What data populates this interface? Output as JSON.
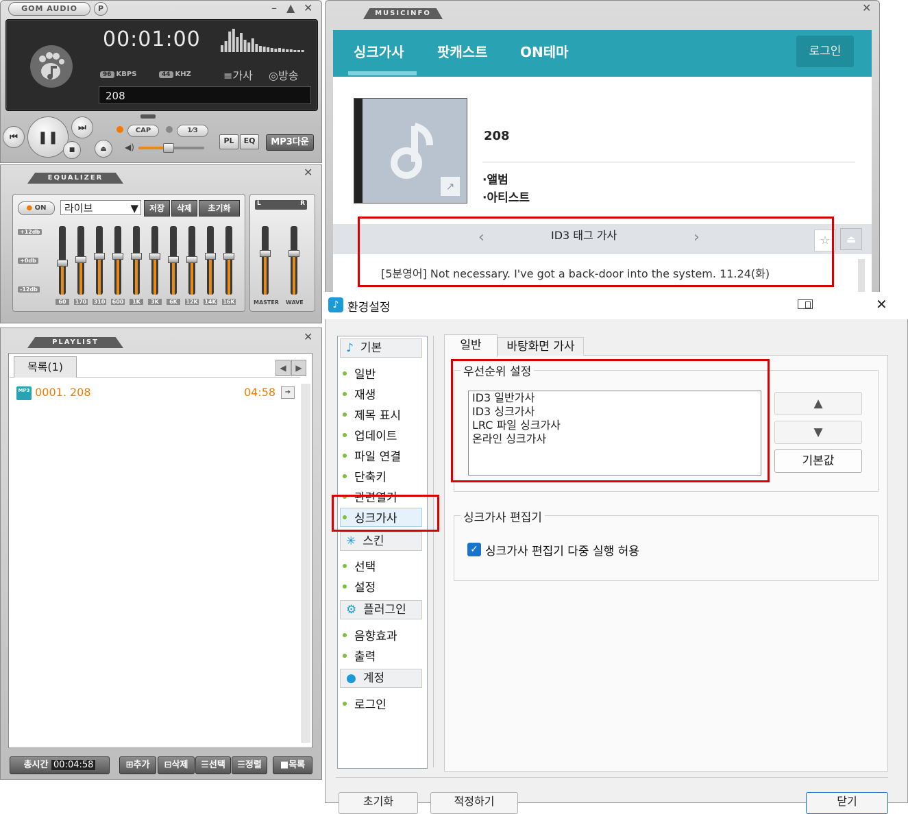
{
  "player": {
    "logo": "GOM AUDIO",
    "p_button": "P",
    "time": "00:01:00",
    "kbps_value": "96",
    "kbps_label": "KBPS",
    "khz_value": "44",
    "khz_label": "KHZ",
    "lyrics_label": "가사",
    "broadcast_label": "방송",
    "track_title": "208",
    "cap_label": "CAP",
    "repeat_label": "1⁄3",
    "pl_label": "PL",
    "eq_label": "EQ",
    "mp3_label": "MP3다운",
    "volume_fraction": 0.45
  },
  "equalizer": {
    "section_title": "EQUALIZER",
    "on_label": "ON",
    "preset": "라이브",
    "save_label": "저장",
    "delete_label": "삭제",
    "reset_label": "초기화",
    "db_labels": [
      "+12db",
      "+0db",
      "-12db"
    ],
    "frequencies": [
      "60",
      "170",
      "310",
      "600",
      "1K",
      "3K",
      "6K",
      "12K",
      "14K",
      "16K"
    ],
    "band_levels": [
      0.45,
      0.5,
      0.55,
      0.55,
      0.55,
      0.55,
      0.5,
      0.5,
      0.55,
      0.55
    ],
    "master_label": "MASTER",
    "wave_label": "WAVE",
    "lr_left": "L",
    "lr_right": "R"
  },
  "playlist": {
    "section_title": "PLAYLIST",
    "tab_label": "목록(1)",
    "rows": [
      {
        "icon": "MP3",
        "title": "0001. 208",
        "duration": "04:58"
      }
    ],
    "total_time_label": "총시간",
    "total_time": "00:04:58",
    "add_label": "추가",
    "delete_label": "삭제",
    "select_label": "선택",
    "sort_label": "정렬",
    "list_label": "목록"
  },
  "musicinfo": {
    "section_title": "MUSICINFO",
    "tabs": [
      "싱크가사",
      "팟캐스트",
      "ON테마"
    ],
    "login_label": "로그인",
    "song_title": "208",
    "album_label": "·앨범",
    "artist_label": "·아티스트",
    "lyric_source": "ID3 태그 가사",
    "lyric_line": "[5분영어] Not necessary. I've got a back-door into the system. 11.24(화)",
    "prev_arrow": "‹",
    "next_arrow": "›"
  },
  "settings": {
    "window_title": "환경설정",
    "close_glyph": "✕",
    "categories": [
      {
        "header": "기본",
        "icon": "music-note-icon",
        "items": [
          "일반",
          "재생",
          "제목 표시",
          "업데이트",
          "파일 연결",
          "단축키",
          "관련열기",
          "싱크가사"
        ]
      },
      {
        "header": "스킨",
        "icon": "sparkle-icon",
        "items": [
          "선택",
          "설정"
        ]
      },
      {
        "header": "플러그인",
        "icon": "gear-icon",
        "items": [
          "음향효과",
          "출력"
        ]
      },
      {
        "header": "계정",
        "icon": "person-icon",
        "items": [
          "로그인"
        ]
      }
    ],
    "tabs": [
      "일반",
      "바탕화면 가사"
    ],
    "priority_group": "우선순위 설정",
    "priority_items": [
      "ID3 일반가사",
      "ID3 싱크가사",
      "LRC 파일 싱크가사",
      "온라인 싱크가사"
    ],
    "up_glyph": "▲",
    "down_glyph": "▼",
    "default_label": "기본값",
    "editor_group": "싱크가사 편집기",
    "editor_checkbox_label": "싱크가사 편집기 다중 실행 허용",
    "editor_checkbox_checked": true,
    "bottom_buttons": [
      "초기화",
      "적정하기",
      "닫기"
    ],
    "colors": {
      "accent": "#1a73c9",
      "nav_dot": "#7fbf3f",
      "teal": "#29a3b3",
      "highlight": "#d90000"
    }
  }
}
